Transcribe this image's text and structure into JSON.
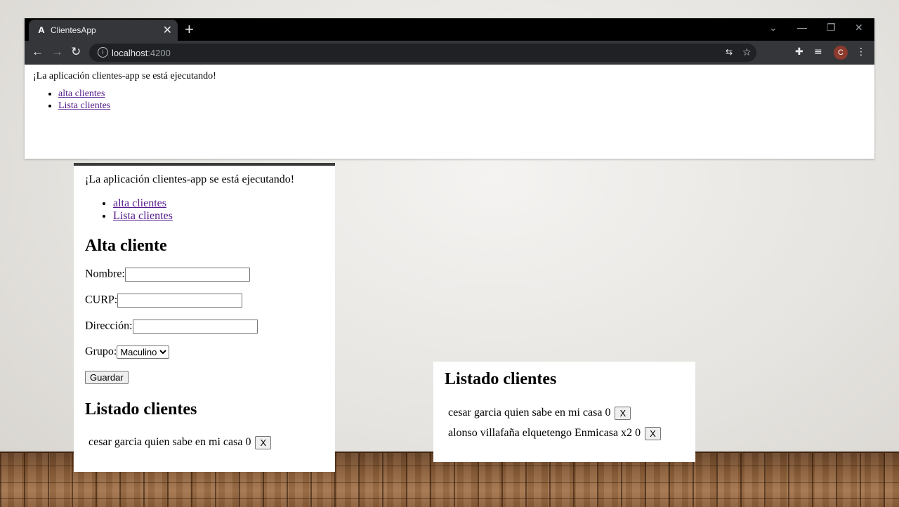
{
  "browser": {
    "tab_title": "ClientesApp",
    "tab_icon": "A",
    "url_host": "localhost",
    "url_port": ":4200",
    "profile_initial": "C",
    "page": {
      "message": "¡La aplicación clientes-app se está ejecutando!",
      "links": [
        "alta clientes",
        "Lista clientes"
      ]
    }
  },
  "left_panel": {
    "message": "¡La aplicación clientes-app se está ejecutando!",
    "links": [
      "alta clientes",
      "Lista clientes"
    ],
    "form_title": "Alta cliente",
    "fields": {
      "nombre_label": "Nombre:",
      "curp_label": "CURP:",
      "direccion_label": "Dirección:",
      "grupo_label": "Grupo:",
      "grupo_selected": "Maculino"
    },
    "save_label": "Guardar",
    "list_title": "Listado clientes",
    "clients": [
      {
        "text": "cesar garcia quien sabe en mi casa 0",
        "delete_label": "X"
      }
    ]
  },
  "right_panel": {
    "list_title": "Listado clientes",
    "clients": [
      {
        "text": "cesar garcia quien sabe en mi casa 0",
        "delete_label": "X"
      },
      {
        "text": "alonso villafaña elquetengo Enmicasa x2 0",
        "delete_label": "X"
      }
    ]
  },
  "icons": {
    "close": "✕",
    "new_tab": "+",
    "back": "←",
    "forward": "→",
    "reload": "↻",
    "star": "☆",
    "menu": "⋮"
  }
}
